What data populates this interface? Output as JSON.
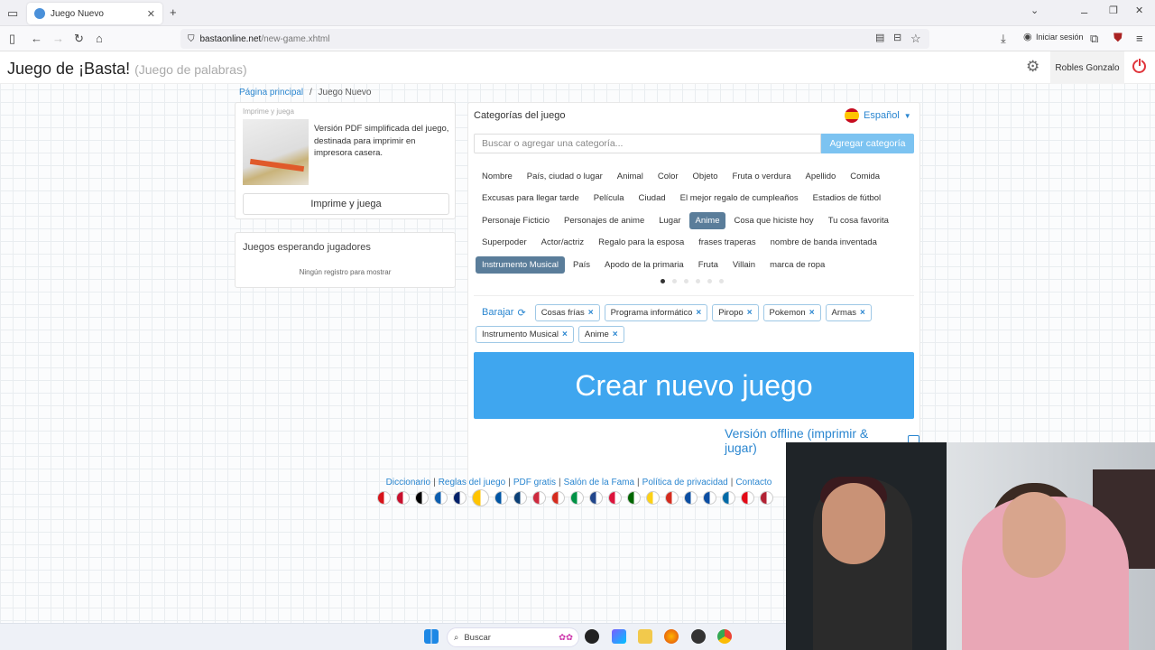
{
  "browser": {
    "tab_title": "Juego Nuevo",
    "url_host": "bastaonline.net",
    "url_path": "/new-game.xhtml",
    "signin_label": "Iniciar sesión"
  },
  "header": {
    "title": "Juego de ¡Basta!",
    "subtitle": "(Juego de palabras)",
    "user_name": "Robles Gonzalo"
  },
  "breadcrumb": {
    "home": "Página principal",
    "separator": "/",
    "current": "Juego Nuevo"
  },
  "print_card": {
    "label": "Imprime y juega",
    "description": "Versión PDF simplificada del juego, destinada para imprimir en impresora casera.",
    "button": "Imprime y juega"
  },
  "waiting_card": {
    "title": "Juegos esperando jugadores",
    "empty": "Ningún registro para mostrar"
  },
  "categories": {
    "title": "Categorías del juego",
    "language": "Español",
    "search_placeholder": "Buscar o agregar una categoría...",
    "add_button": "Agregar categoría",
    "rows": [
      [
        "Nombre",
        "País, ciudad o lugar",
        "Animal",
        "Color",
        "Objeto",
        "Fruta o verdura",
        "Apellido",
        "Comida"
      ],
      [
        "Excusas para llegar tarde",
        "Película",
        "Ciudad",
        "El mejor regalo de cumpleaños",
        "Estadios de fútbol"
      ],
      [
        "Personaje Ficticio",
        "Personajes de anime",
        "Lugar",
        "Anime",
        "Cosa que hiciste hoy",
        "Tu cosa favorita"
      ],
      [
        "Superpoder",
        "Actor/actriz",
        "Regalo para la esposa",
        "frases traperas",
        "nombre de banda inventada"
      ],
      [
        "Instrumento Musical",
        "País",
        "Apodo de la primaria",
        "Fruta",
        "Villain",
        "marca de ropa"
      ]
    ],
    "selected": [
      "Anime",
      "Instrumento Musical"
    ],
    "page_count": 6,
    "current_page": 1
  },
  "selection": {
    "shuffle_label": "Barajar",
    "row1": [
      "Cosas frías",
      "Programa informático",
      "Piropo",
      "Pokemon",
      "Armas"
    ],
    "row2": [
      "Instrumento Musical",
      "Anime"
    ],
    "remove_glyph": "×"
  },
  "create_button": "Crear nuevo juego",
  "offline_link": "Versión offline (imprimir & jugar)",
  "footer": {
    "links": [
      "Diccionario",
      "Reglas del juego",
      "PDF gratis",
      "Salón de la Fama",
      "Política de privacidad",
      "Contacto"
    ],
    "separator": "|"
  },
  "taskbar": {
    "search_label": "Buscar"
  },
  "colors": {
    "accent": "#3fa6ef",
    "link": "#2a86d0",
    "selected_chip": "#5a7d9a"
  }
}
